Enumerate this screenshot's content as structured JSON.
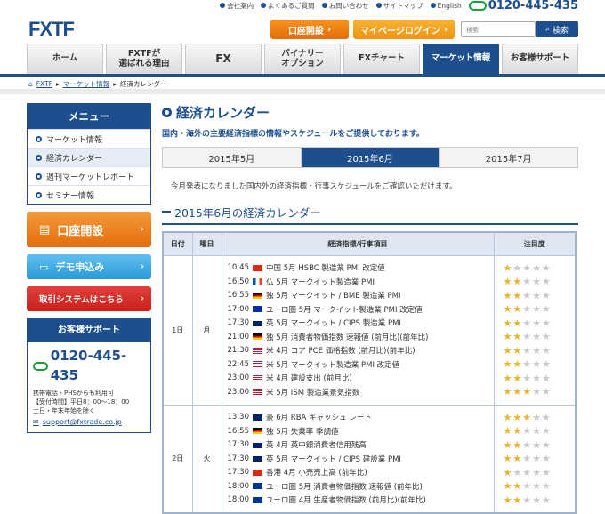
{
  "topbar": {
    "links": [
      "会社案内",
      "よくあるご質問",
      "お問い合わせ",
      "サイトマップ",
      "English"
    ],
    "phone": "0120-445-435"
  },
  "logo": "FXTF",
  "header": {
    "open_account": "口座開設",
    "login": "マイページログイン",
    "search_placeholder": "検索",
    "search_btn": "検索"
  },
  "nav": [
    {
      "label": "ホーム"
    },
    {
      "label": "FXTFが\n選ばれる理由"
    },
    {
      "label": "FX"
    },
    {
      "label": "バイナリー\nオプション"
    },
    {
      "label": "FXチャート"
    },
    {
      "label": "マーケット情報"
    },
    {
      "label": "お客様サポート"
    }
  ],
  "breadcrumb": {
    "home": "FXTF",
    "parent": "マーケット情報",
    "current": "経済カレンダー"
  },
  "menu": {
    "title": "メニュー",
    "items": [
      "マーケット情報",
      "経済カレンダー",
      "週刊マーケットレポート",
      "セミナー情報"
    ]
  },
  "side_buttons": {
    "open": "口座開設",
    "demo": "デモ申込み",
    "system": "取引システムはこちら"
  },
  "support": {
    "title": "お客様サポート",
    "phone": "0120-445-435",
    "lines": [
      "携帯電話・PHSからも利用可",
      "【受付時間】平日8：00～18：00",
      "土日・年末年始を除く"
    ],
    "email": "support@fxtrade.co.jp"
  },
  "page": {
    "title": "経済カレンダー",
    "desc": "国内・海外の主要経済指標の情報やスケジュールをご提供しております。",
    "tabs": [
      "2015年5月",
      "2015年6月",
      "2015年7月"
    ],
    "note": "今月発表になりました国内外の経済指標・行事スケジュールをご確認いただけます。",
    "section": "2015年6月の経済カレンダー"
  },
  "table": {
    "headers": [
      "日付",
      "曜日",
      "経済指標/行事項目",
      "注目度"
    ],
    "days": [
      {
        "date": "1日",
        "weekday": "月",
        "events": [
          {
            "time": "10:45",
            "flag": "cn",
            "text": "中国 5月 HSBC 製造業 PMI 改定値",
            "stars": 1
          },
          {
            "time": "16:50",
            "flag": "fr",
            "text": "仏 5月 マークイット製造業 PMI",
            "stars": 2
          },
          {
            "time": "16:55",
            "flag": "de",
            "text": "独 5月 マークイット / BME 製造業 PMI",
            "stars": 2
          },
          {
            "time": "17:00",
            "flag": "eu",
            "text": "ユーロ圏 5月 マークイット製造業 PMI 改定値",
            "stars": 2
          },
          {
            "time": "17:30",
            "flag": "gb",
            "text": "英 5月 マークイット / CIPS 製造業 PMI",
            "stars": 2
          },
          {
            "time": "21:00",
            "flag": "de",
            "text": "独 5月 消費者物価指数 速報値 (前月比)(前年比)",
            "stars": 2
          },
          {
            "time": "21:30",
            "flag": "us",
            "text": "米 4月 コア PCE 価格指数 (前月比)(前年比)",
            "stars": 2
          },
          {
            "time": "22:45",
            "flag": "us",
            "text": "米 5月 マークイット製造業 PMI 改定値",
            "stars": 2
          },
          {
            "time": "23:00",
            "flag": "us",
            "text": "米 4月 建設支出 (前月比)",
            "stars": 2
          },
          {
            "time": "23:00",
            "flag": "us",
            "text": "米 5月 ISM 製造業景気指数",
            "stars": 3
          }
        ]
      },
      {
        "date": "2日",
        "weekday": "火",
        "events": [
          {
            "time": "13:30",
            "flag": "au",
            "text": "豪 6月 RBA キャッシュ レート",
            "stars": 3
          },
          {
            "time": "16:55",
            "flag": "de",
            "text": "独 5月 失業率 季調値",
            "stars": 2
          },
          {
            "time": "17:30",
            "flag": "gb",
            "text": "英 4月 英中銀消費者信用残高",
            "stars": 2
          },
          {
            "time": "17:30",
            "flag": "gb",
            "text": "英 5月 マークイット / CIPS 建設業 PMI",
            "stars": 2
          },
          {
            "time": "17:30",
            "flag": "hk",
            "text": "香港 4月 小売売上高 (前年比)",
            "stars": 1
          },
          {
            "time": "18:00",
            "flag": "eu",
            "text": "ユーロ圏 5月 消費者物価指数 速報値 (前年比)",
            "stars": 2
          },
          {
            "time": "18:00",
            "flag": "eu",
            "text": "ユーロ圏 4月 生産者物価指数 (前月比)(前年比)",
            "stars": 2
          }
        ]
      }
    ]
  },
  "colors": {
    "brand": "#1d4f8f",
    "orange": "#e46c0a",
    "star": "#e8b42a"
  }
}
